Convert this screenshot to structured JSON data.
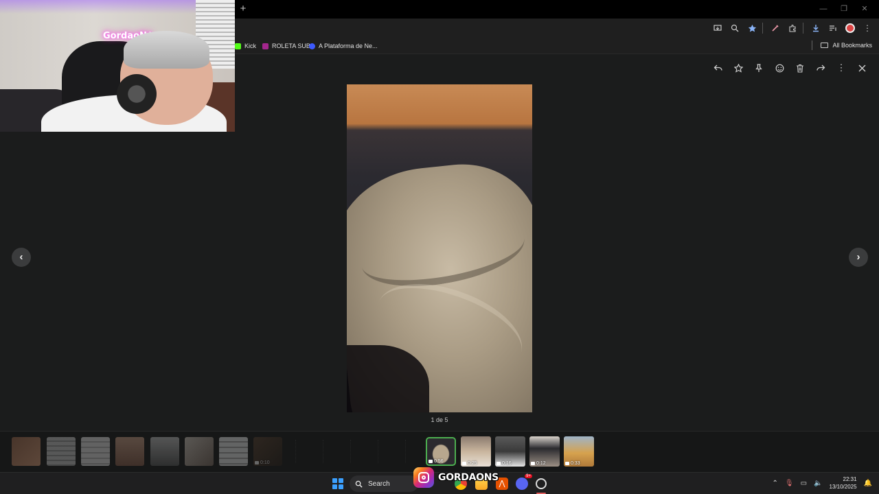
{
  "bookmarks": [
    {
      "label": "Kick",
      "color": "#53fc18"
    },
    {
      "label": "ROLETA SUB",
      "color": "#a4268d"
    },
    {
      "label": "A Plataforma de Ne...",
      "color": "#3d5afe"
    }
  ],
  "bookmarks_all": "All Bookmarks",
  "viewer": {
    "counter": "1 de 5",
    "actions": [
      "reply-icon",
      "star-icon",
      "pin-icon",
      "emoji-icon",
      "trash-icon",
      "forward-icon",
      "more-icon",
      "close-icon"
    ]
  },
  "thumbnails": [
    {
      "duration": "0:56",
      "selected": true
    },
    {
      "duration": "0:25"
    },
    {
      "duration": "0:16"
    },
    {
      "duration": "0:12"
    },
    {
      "duration": "0:33"
    }
  ],
  "old_thumbnail_duration": "0:10",
  "taskbar": {
    "search_label": "Search",
    "time": "22:31",
    "date": "13/10/2025",
    "discord_badge": "9+"
  },
  "overlay": {
    "instagram_handle": "GORDAONS"
  },
  "webcam": {
    "neon_sign": "GordaoN$"
  }
}
